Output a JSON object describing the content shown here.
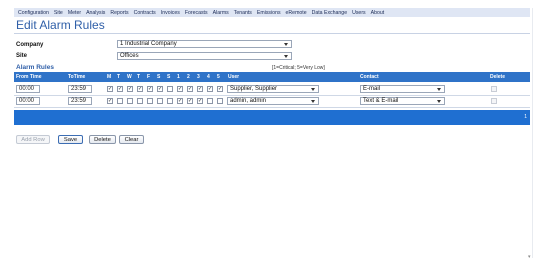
{
  "menu": [
    "Configuration",
    "Site",
    "Meter",
    "Analysis",
    "Reports",
    "Contracts",
    "Invoices",
    "Forecasts",
    "Alarms",
    "Tenants",
    "Emissions",
    "eRemote",
    "Data Exchange",
    "Users",
    "About"
  ],
  "page_title": "Edit Alarm Rules",
  "form": {
    "company_label": "Company",
    "company_value": "1 Industrial Company",
    "site_label": "Site",
    "site_value": "Offices"
  },
  "section": {
    "title": "Alarm Rules",
    "note": "[1=Critical; 5=Very Low]"
  },
  "table_headers": {
    "from_time": "From Time",
    "to_time": "ToTime",
    "days": [
      "M",
      "T",
      "W",
      "T",
      "F",
      "S",
      "S"
    ],
    "priorities": [
      "1",
      "2",
      "3",
      "4",
      "5"
    ],
    "user": "User",
    "contact": "Contact",
    "delete": "Delete"
  },
  "rows": [
    {
      "from": "00:00",
      "to": "23:59",
      "days": [
        true,
        true,
        true,
        true,
        true,
        true,
        false
      ],
      "priorities": [
        true,
        true,
        true,
        true,
        true
      ],
      "user": "Supplier, Supplier",
      "contact": "E-mail",
      "delete": false
    },
    {
      "from": "00:00",
      "to": "23:59",
      "days": [
        true,
        false,
        false,
        false,
        false,
        false,
        false
      ],
      "priorities": [
        true,
        true,
        true,
        false,
        false
      ],
      "user": "admin, admin",
      "contact": "Text & E-mail",
      "delete": false
    }
  ],
  "footer_mark": "1",
  "buttons": {
    "add_row": "Add Row",
    "save": "Save",
    "delete": "Delete",
    "clear": "Clear"
  },
  "colors": {
    "accent": "#2f73c8",
    "title": "#2f5fa8",
    "menubar": "#dfe6f4"
  }
}
